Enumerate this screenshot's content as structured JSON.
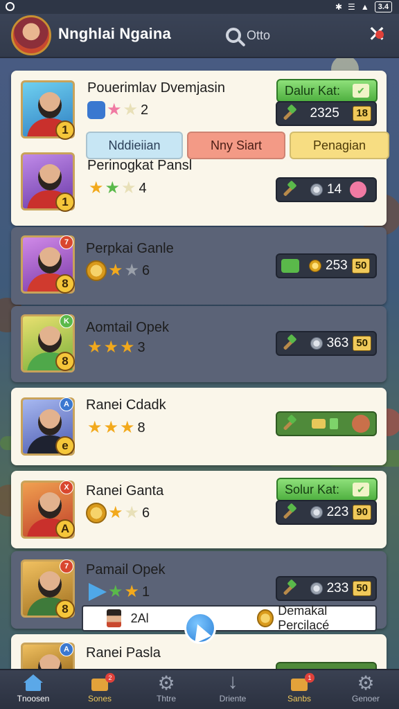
{
  "status_bar": {
    "battery": "3.4"
  },
  "header": {
    "player_name": "Nnghlai Ngaina",
    "search_label": "Otto"
  },
  "list": [
    {
      "name": "Pouerimlav Dvemjasin",
      "level": "1",
      "stars": 2,
      "green_button": "Dalur Kat:",
      "pill_value": "2325",
      "pill_tag": "18"
    },
    {
      "name": "Perinogkat Pansl",
      "level": "1",
      "stars": 4,
      "pill_value": "14"
    },
    {
      "name": "Perpkai Ganle",
      "level": "8",
      "corner": "7",
      "stars": 6,
      "pill_value": "253",
      "pill_tag": "50"
    },
    {
      "name": "Aomtail Opek",
      "level": "8",
      "corner": "K",
      "stars": 3,
      "pill_value": "363",
      "pill_tag": "50"
    },
    {
      "name": "Ranei Cdadk",
      "level": "e",
      "corner": "A",
      "stars": 8
    },
    {
      "name": "Ranei Ganta",
      "level": "A",
      "corner": "X",
      "stars": 6,
      "green_button": "Solur Kat:",
      "pill_value": "223",
      "pill_tag": "90"
    },
    {
      "name": "Pamail Opek",
      "level": "8",
      "corner": "7",
      "stars": 1,
      "pill_value": "233",
      "pill_tag": "50"
    },
    {
      "name": "Ranei Pasla",
      "corner": "A"
    }
  ],
  "filter_tabs": [
    "Nddieiian",
    "Nny Siart",
    "Penagian"
  ],
  "toast": {
    "left": "2Al",
    "right": "Demakal Percilacé"
  },
  "bottom_nav": [
    {
      "label": "Tnoosen"
    },
    {
      "label": "Sones",
      "badge": "2"
    },
    {
      "label": "Thtre"
    },
    {
      "label": "Driente"
    },
    {
      "label": "Sanbs",
      "badge": "1"
    },
    {
      "label": "Genoer"
    }
  ],
  "colors": {
    "accent": "#4fb040",
    "header": "#323a4b",
    "tag": "#f0c95a"
  }
}
